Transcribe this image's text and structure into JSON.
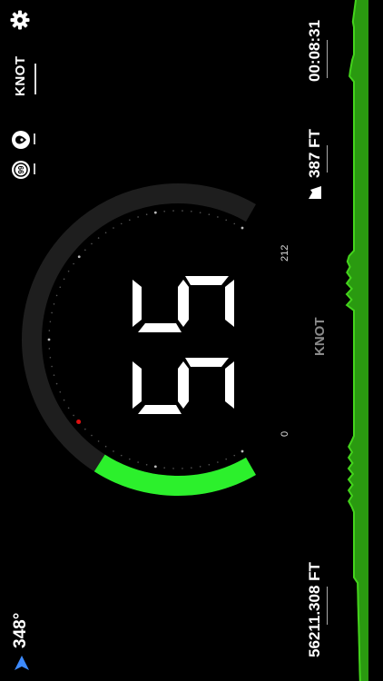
{
  "settings": {
    "icon": "gear-icon"
  },
  "speed_unit_toggle": {
    "label": "KNOT"
  },
  "mode_icons": [
    {
      "icon": "location-pin-icon"
    },
    {
      "icon": "speed-limit-icon"
    }
  ],
  "trip": {
    "elapsed_time": "00:08:31",
    "altitude": "387 FT",
    "altitude_icon": "mountain-icon",
    "distance": "56211.308 FT"
  },
  "compass": {
    "heading": "348°",
    "icon": "navigation-arrow-icon"
  },
  "speedometer": {
    "speed_display": "55",
    "unit": "KNOT",
    "scale_max": "212",
    "scale_min": "0",
    "speed_value": 55,
    "scale_max_value": 212,
    "arc_fill_fraction": 0.26,
    "arc_color": "#2cf02c",
    "track_color": "#1e1e1e",
    "needle_marker_color": "#e01010"
  },
  "speed_graph": {
    "color": "#2a9a10",
    "edge_color": "#44d41c"
  }
}
